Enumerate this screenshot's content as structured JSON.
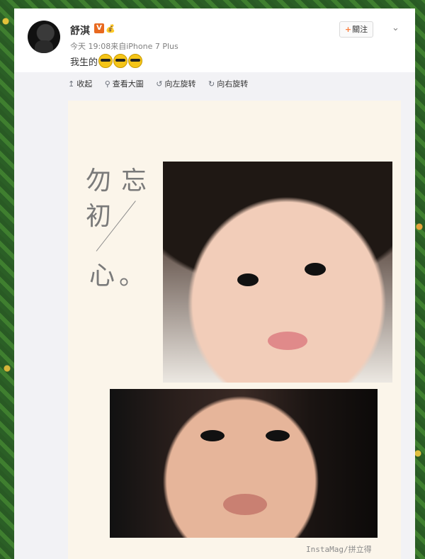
{
  "post": {
    "username": "舒淇",
    "verified_badge": "V",
    "member_badge": "💰",
    "timestamp": "今天 19:08",
    "source": "来自iPhone 7 Plus",
    "text": "我生的",
    "emoji_count": 3,
    "emoji_name": "cool-sunglasses"
  },
  "actions": {
    "follow_label": "關注",
    "follow_plus": "+",
    "more_icon": "chevron-down-icon"
  },
  "toolbar": {
    "items": [
      {
        "icon": "↥",
        "icon_name": "collapse-icon",
        "label": "收起"
      },
      {
        "icon": "⚲",
        "icon_name": "zoom-icon",
        "label": "查看大圖"
      },
      {
        "icon": "↺",
        "icon_name": "rotate-left-icon",
        "label": "向左旋转"
      },
      {
        "icon": "↻",
        "icon_name": "rotate-right-icon",
        "label": "向右旋转"
      }
    ]
  },
  "image": {
    "calligraphy": {
      "c1": "勿",
      "c2": "忘",
      "c3": "初",
      "c4": "心",
      "c5": "。"
    },
    "watermark": "InstaMag/拼立得"
  },
  "colors": {
    "accent": "#fa7d3c",
    "verified": "#e8691f",
    "meta_text": "#808080",
    "panel_bg": "#f2f2f5",
    "collage_bg": "#fbf5ea"
  }
}
